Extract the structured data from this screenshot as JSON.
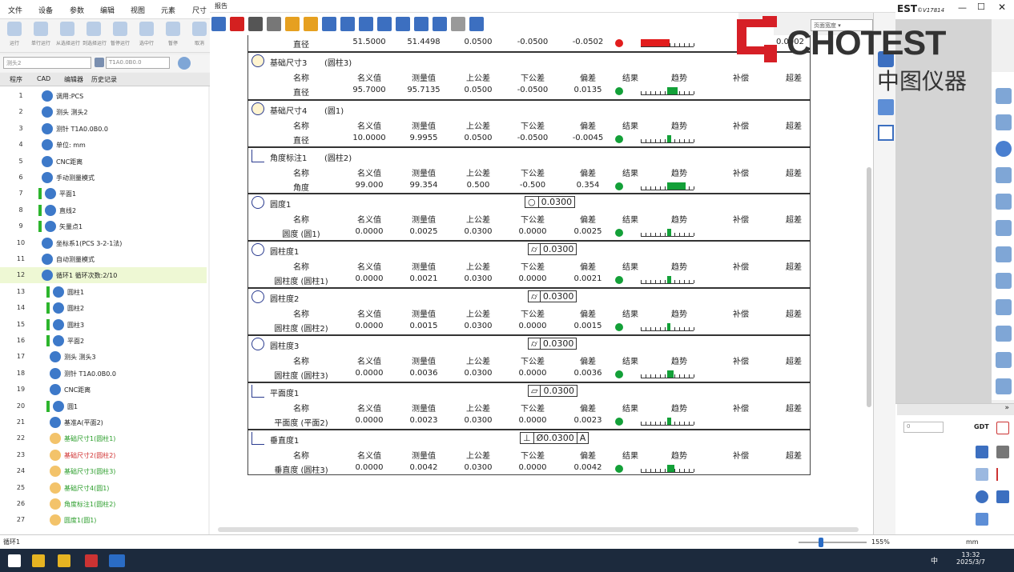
{
  "menu": [
    "文件",
    "设备",
    "参数",
    "编辑",
    "视图",
    "元素",
    "尺寸"
  ],
  "left_toolbar": [
    "运行",
    "单行运行",
    "从选择运行",
    "到选择运行",
    "暂停运行",
    "选中行",
    "暂停",
    "取消"
  ],
  "probe_select": "测头2",
  "tip_select": "T1A0.0B0.0",
  "left_tabs": [
    "程序",
    "CAD",
    "编辑器",
    "历史记录"
  ],
  "tree": [
    {
      "n": "1",
      "t": "调用:PCS"
    },
    {
      "n": "2",
      "t": "测头 测头2"
    },
    {
      "n": "3",
      "t": "测针 T1A0.0B0.0"
    },
    {
      "n": "4",
      "t": "单位: mm"
    },
    {
      "n": "5",
      "t": "CNC距离"
    },
    {
      "n": "6",
      "t": "手动测量模式"
    },
    {
      "n": "7",
      "t": "平面1"
    },
    {
      "n": "8",
      "t": "直线2"
    },
    {
      "n": "9",
      "t": "矢量点1"
    },
    {
      "n": "10",
      "t": "坐标系1(PCS 3-2-1法)"
    },
    {
      "n": "11",
      "t": "自动测量模式"
    },
    {
      "n": "12",
      "t": "循环1 循环次数:2/10"
    },
    {
      "n": "13",
      "t": "圆柱1"
    },
    {
      "n": "14",
      "t": "圆柱2"
    },
    {
      "n": "15",
      "t": "圆柱3"
    },
    {
      "n": "16",
      "t": "平面2"
    },
    {
      "n": "17",
      "t": "测头 测头3"
    },
    {
      "n": "18",
      "t": "测针 T1A0.0B0.0"
    },
    {
      "n": "19",
      "t": "CNC距离"
    },
    {
      "n": "20",
      "t": "圆1"
    },
    {
      "n": "21",
      "t": "基准A(平面2)"
    },
    {
      "n": "22",
      "t": "基础尺寸1(圆柱1)"
    },
    {
      "n": "23",
      "t": "基础尺寸2(圆柱2)"
    },
    {
      "n": "24",
      "t": "基础尺寸3(圆柱3)"
    },
    {
      "n": "25",
      "t": "基础尺寸4(圆1)"
    },
    {
      "n": "26",
      "t": "角度标注1(圆柱2)"
    },
    {
      "n": "27",
      "t": "圆度1(圆1)"
    }
  ],
  "left_status": "循环1",
  "report_title": "报告",
  "report_select": "页面宽度",
  "headers": {
    "name": "名称",
    "nominal": "名义值",
    "measured": "测量值",
    "upper": "上公差",
    "lower": "下公差",
    "dev": "偏差",
    "result": "结果",
    "trend": "趋势",
    "comp": "补偿",
    "exceed": "超差"
  },
  "top_row": {
    "name": "直径",
    "nominal": "51.5000",
    "measured": "51.4498",
    "upper": "0.0500",
    "lower": "-0.0500",
    "dev": "-0.0502",
    "result": "fail",
    "fill": 0.55,
    "exceed": "0.0002"
  },
  "blocks": [
    {
      "title": "基础尺寸3",
      "sub": "(圆柱3)",
      "icon": "diameter-icon",
      "tol": "",
      "name": "直径",
      "nominal": "95.7000",
      "measured": "95.7135",
      "upper": "0.0500",
      "lower": "-0.0500",
      "dev": "0.0135",
      "fill": 0.2
    },
    {
      "title": "基础尺寸4",
      "sub": "(圆1)",
      "icon": "diameter-icon",
      "tol": "",
      "name": "直径",
      "nominal": "10.0000",
      "measured": "9.9955",
      "upper": "0.0500",
      "lower": "-0.0500",
      "dev": "-0.0045",
      "fill": 0.08
    },
    {
      "title": "角度标注1",
      "sub": "(圆柱2)",
      "icon": "angle-icon",
      "tol": "",
      "name": "角度",
      "nominal": "99.000",
      "measured": "99.354",
      "upper": "0.500",
      "lower": "-0.500",
      "dev": "0.354",
      "fill": 0.35
    },
    {
      "title": "圆度1",
      "sub": "",
      "icon": "roundness-icon",
      "tol": "0.0300",
      "tolsym": "○",
      "name": "圆度 (圆1)",
      "nominal": "0.0000",
      "measured": "0.0025",
      "upper": "0.0300",
      "lower": "0.0000",
      "dev": "0.0025",
      "fill": 0.08
    },
    {
      "title": "圆柱度1",
      "sub": "",
      "icon": "cylindricity-icon",
      "tol": "0.0300",
      "tolsym": "⌭",
      "name": "圆柱度 (圆柱1)",
      "nominal": "0.0000",
      "measured": "0.0021",
      "upper": "0.0300",
      "lower": "0.0000",
      "dev": "0.0021",
      "fill": 0.07
    },
    {
      "title": "圆柱度2",
      "sub": "",
      "icon": "cylindricity-icon",
      "tol": "0.0300",
      "tolsym": "⌭",
      "name": "圆柱度 (圆柱2)",
      "nominal": "0.0000",
      "measured": "0.0015",
      "upper": "0.0300",
      "lower": "0.0000",
      "dev": "0.0015",
      "fill": 0.05
    },
    {
      "title": "圆柱度3",
      "sub": "",
      "icon": "cylindricity-icon",
      "tol": "0.0300",
      "tolsym": "⌭",
      "name": "圆柱度 (圆柱3)",
      "nominal": "0.0000",
      "measured": "0.0036",
      "upper": "0.0300",
      "lower": "0.0000",
      "dev": "0.0036",
      "fill": 0.12
    },
    {
      "title": "平面度1",
      "sub": "",
      "icon": "flatness-icon",
      "tol": "0.0300",
      "tolsym": "▱",
      "name": "平面度 (平面2)",
      "nominal": "0.0000",
      "measured": "0.0023",
      "upper": "0.0300",
      "lower": "0.0000",
      "dev": "0.0023",
      "fill": 0.08
    },
    {
      "title": "垂直度1",
      "sub": "",
      "icon": "perpendicularity-icon",
      "tol": "Ø0.0300",
      "tolsym": "⊥",
      "datum": "A",
      "name": "垂直度 (圆柱3)",
      "nominal": "0.0000",
      "measured": "0.0042",
      "upper": "0.0300",
      "lower": "0.0000",
      "dev": "0.0042",
      "fill": 0.14
    }
  ],
  "brand": {
    "name": "CHOTEST",
    "cn": "中图仪器",
    "version": "©V17814",
    "title_frag": "EST"
  },
  "zoom": "155%",
  "units": "mm",
  "right_field": "0",
  "gdt_label": "GDT",
  "clock": {
    "time": "13:32",
    "date": "2025/3/7"
  },
  "tray": "中",
  "colors": {
    "pass": "#13a038",
    "fail": "#e21d1d",
    "brand_red": "#d61f26",
    "brand_dark": "#333333"
  }
}
